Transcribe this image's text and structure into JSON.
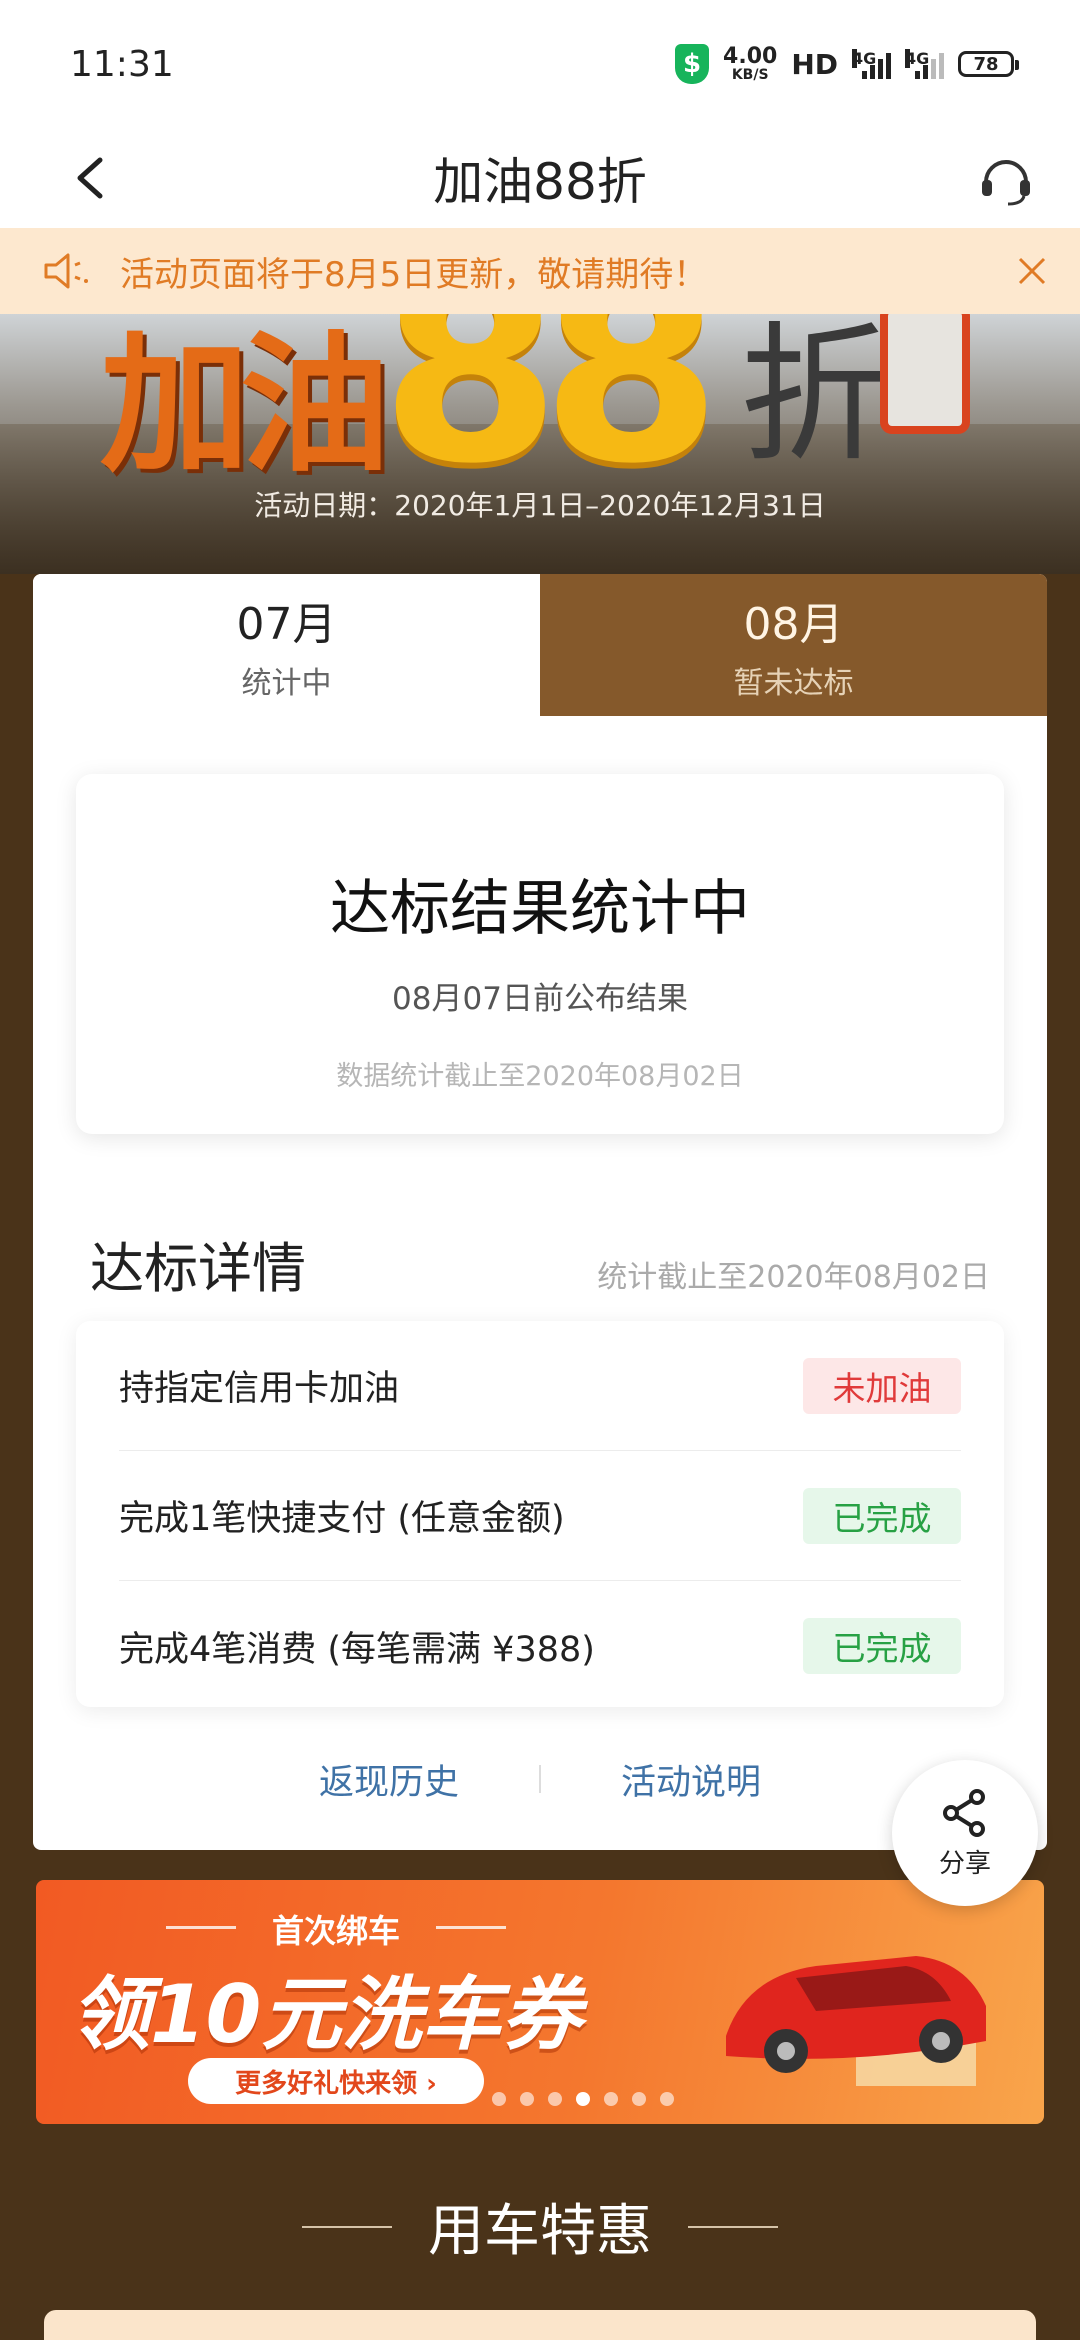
{
  "status_bar": {
    "time": "11:31",
    "net_speed_value": "4.00",
    "net_speed_unit": "KB/S",
    "hd_label": "HD",
    "signal1_label": "4G",
    "signal2_label": "4G",
    "battery": "78"
  },
  "nav": {
    "title": "加油88折"
  },
  "notice": {
    "text": "活动页面将于8月5日更新，敬请期待！"
  },
  "hero": {
    "jia_you": "加油",
    "eighty_eight": "88",
    "zhe": "折",
    "date_range": "活动日期：2020年1月1日–2020年12月31日"
  },
  "tabs": [
    {
      "month": "07月",
      "status": "统计中",
      "active": true
    },
    {
      "month": "08月",
      "status": "暂未达标",
      "active": false
    }
  ],
  "result": {
    "title": "达标结果统计中",
    "subtitle": "08月07日前公布结果",
    "note": "数据统计截止至2020年08月02日"
  },
  "details": {
    "title": "达标详情",
    "date": "统计截止至2020年08月02日",
    "tasks": [
      {
        "name": "持指定信用卡加油",
        "status": "未加油",
        "status_color": "#e03a3a"
      },
      {
        "name": "完成1笔快捷支付 (任意金额)",
        "status": "已完成",
        "status_color": "#27a144"
      },
      {
        "name": "完成4笔消费 (每笔需满 ¥388)",
        "status": "已完成",
        "status_color": "#27a144"
      }
    ]
  },
  "links": {
    "history": "返现历史",
    "rules": "活动说明"
  },
  "share": {
    "label": "分享"
  },
  "promo": {
    "tag": "首次绑车",
    "main": "领10元洗车券",
    "button": "更多好礼快来领 ›",
    "slide_count": 7,
    "active_slide": 3
  },
  "section": {
    "title": "用车特惠"
  },
  "colors": {
    "page_bg": "#4a3319",
    "tab_inactive": "#85592b",
    "notice_text": "#e07b25",
    "link": "#3f72a6"
  }
}
